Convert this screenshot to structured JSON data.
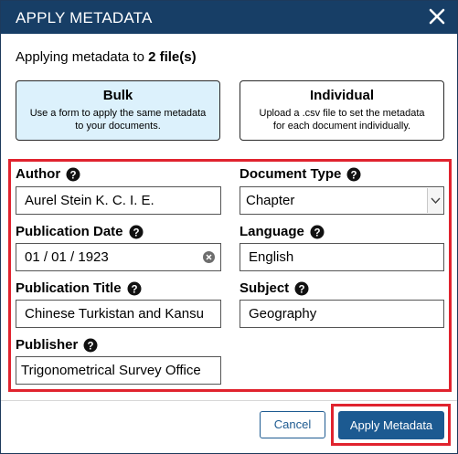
{
  "dialog": {
    "title": "APPLY METADATA",
    "intro_prefix": "Applying metadata to ",
    "intro_count": "2 file(s)"
  },
  "modes": {
    "bulk": {
      "title": "Bulk",
      "description": "Use a form to apply the same metadata to your documents.",
      "selected": true
    },
    "individual": {
      "title": "Individual",
      "description": "Upload a .csv file to set the metadata for each document individually.",
      "selected": false
    }
  },
  "fields": {
    "author": {
      "label": "Author",
      "value": "Aurel Stein K. C. I. E."
    },
    "document_type": {
      "label": "Document Type",
      "value": "Chapter"
    },
    "publication_date": {
      "label": "Publication Date",
      "value": "01 / 01 / 1923"
    },
    "language": {
      "label": "Language",
      "value": "English"
    },
    "publication_title": {
      "label": "Publication Title",
      "value": "Chinese Turkistan and Kansu"
    },
    "subject": {
      "label": "Subject",
      "value": "Geography"
    },
    "publisher": {
      "label": "Publisher",
      "value": "Trigonometrical Survey Office"
    }
  },
  "buttons": {
    "cancel": "Cancel",
    "apply": "Apply Metadata"
  },
  "colors": {
    "titlebar": "#173e66",
    "selected_card": "#dcf1fc",
    "highlight_outline": "#e0232e",
    "primary_button": "#1c5a91"
  },
  "icons": {
    "close": "close-icon",
    "help": "help-circle-icon",
    "clear": "clear-circle-icon",
    "dropdown": "chevron-down-icon"
  }
}
